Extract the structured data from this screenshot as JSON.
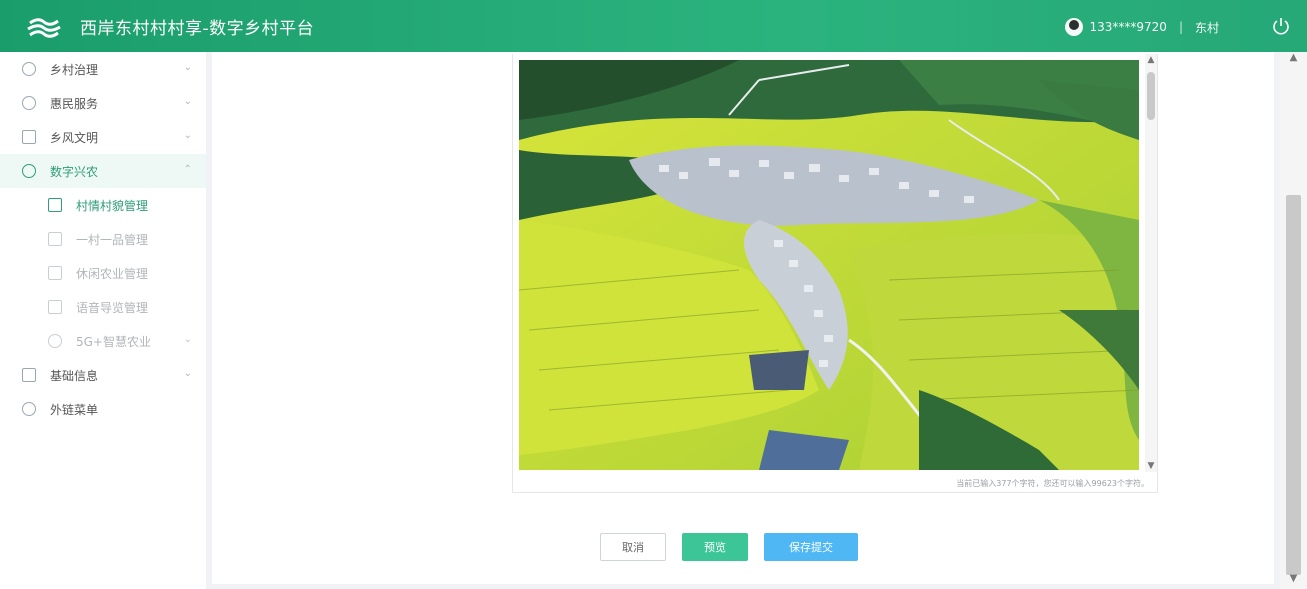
{
  "header": {
    "title": "西岸东村村村享-数字乡村平台",
    "user_phone": "133****9720",
    "user_separator": "|",
    "user_village": "东村"
  },
  "sidebar": {
    "items": [
      {
        "label": "乡村治理",
        "icon": "circle-icon",
        "expanded": false
      },
      {
        "label": "惠民服务",
        "icon": "circle-icon",
        "expanded": false
      },
      {
        "label": "乡风文明",
        "icon": "document-icon",
        "expanded": false
      },
      {
        "label": "数字兴农",
        "icon": "gear-icon",
        "expanded": true,
        "active": true
      },
      {
        "label": "基础信息",
        "icon": "grid-icon",
        "expanded": false
      },
      {
        "label": "外链菜单",
        "icon": "link-icon"
      }
    ],
    "subitems": [
      {
        "label": "村情村貌管理",
        "active": true
      },
      {
        "label": "一村一品管理"
      },
      {
        "label": "休闲农业管理"
      },
      {
        "label": "语音导览管理"
      },
      {
        "label": "5G+智慧农业",
        "has_children": true
      }
    ]
  },
  "editor": {
    "counter": "当前已输入377个字符，您还可以输入99623个字符。"
  },
  "actions": {
    "cancel_label": "取消",
    "preview_label": "预览",
    "save_label": "保存提交"
  },
  "colors": {
    "header_green": "#1a9d6b",
    "active_green": "#2f9d77",
    "preview_green": "#3cc596",
    "save_blue": "#4fb7f4"
  }
}
